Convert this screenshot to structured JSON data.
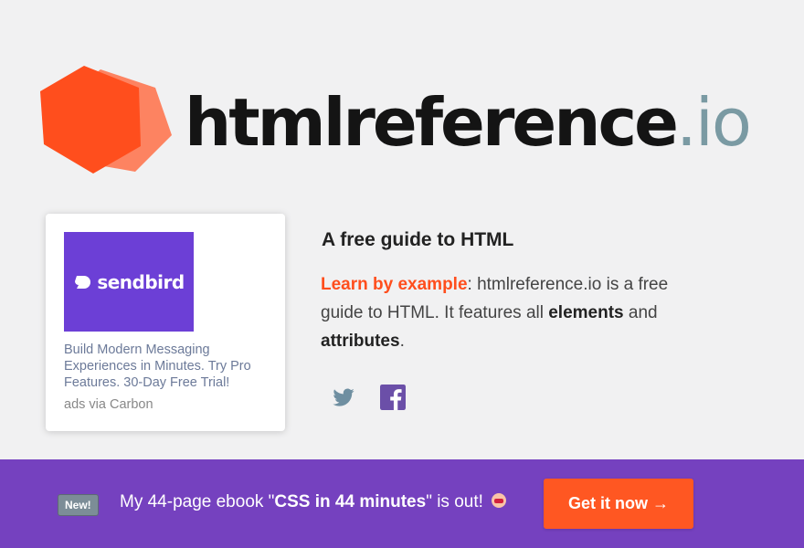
{
  "logo": {
    "name": "htmlreference",
    "tld": ".io"
  },
  "ad": {
    "brand": "sendbird",
    "text": "Build Modern Messaging Experiences in Minutes. Try Pro Features. 30-Day Free Trial!",
    "via": "ads via Carbon"
  },
  "intro": {
    "title": "A free guide to HTML",
    "accent": "Learn by example",
    "p1": ": htmlreference.io is a free guide to HTML. It features all ",
    "elements": "elements",
    "and": " and ",
    "attributes": "attributes",
    "end": "."
  },
  "social": {
    "twitter": "twitter-icon",
    "facebook": "facebook-icon"
  },
  "banner": {
    "badge": "New!",
    "prefix": "My 44-page ebook \"",
    "book": "CSS in 44 minutes",
    "suffix": "\" is out! ",
    "cta": "Get it now →"
  },
  "colors": {
    "accent": "#ff4e1d",
    "banner": "#7541bf",
    "cta": "#ff5722",
    "ad_bg": "#6c3fd6"
  }
}
